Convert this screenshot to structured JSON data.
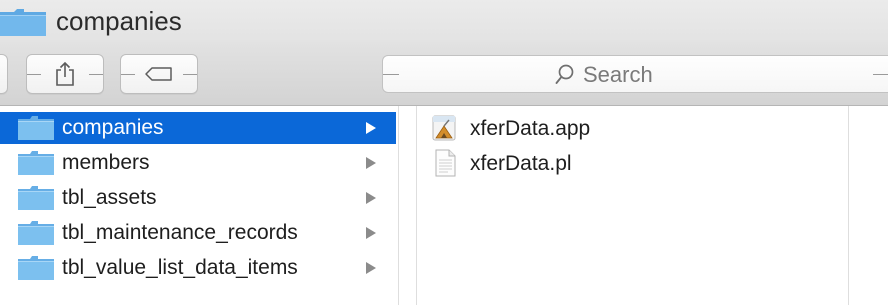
{
  "window": {
    "title": "companies"
  },
  "toolbar": {
    "search_placeholder": "Search"
  },
  "colors": {
    "selection": "#0b68d8",
    "folder": "#6fb6ea"
  },
  "column1": {
    "items": [
      {
        "label": "companies",
        "icon": "folder-icon",
        "selected": true
      },
      {
        "label": "members",
        "icon": "folder-icon",
        "selected": false
      },
      {
        "label": "tbl_assets",
        "icon": "folder-icon",
        "selected": false
      },
      {
        "label": "tbl_maintenance_records",
        "icon": "folder-icon",
        "selected": false
      },
      {
        "label": "tbl_value_list_data_items",
        "icon": "folder-icon",
        "selected": false
      }
    ]
  },
  "column2": {
    "items": [
      {
        "label": "xferData.app",
        "icon": "app-icon"
      },
      {
        "label": "xferData.pl",
        "icon": "document-icon"
      }
    ]
  }
}
